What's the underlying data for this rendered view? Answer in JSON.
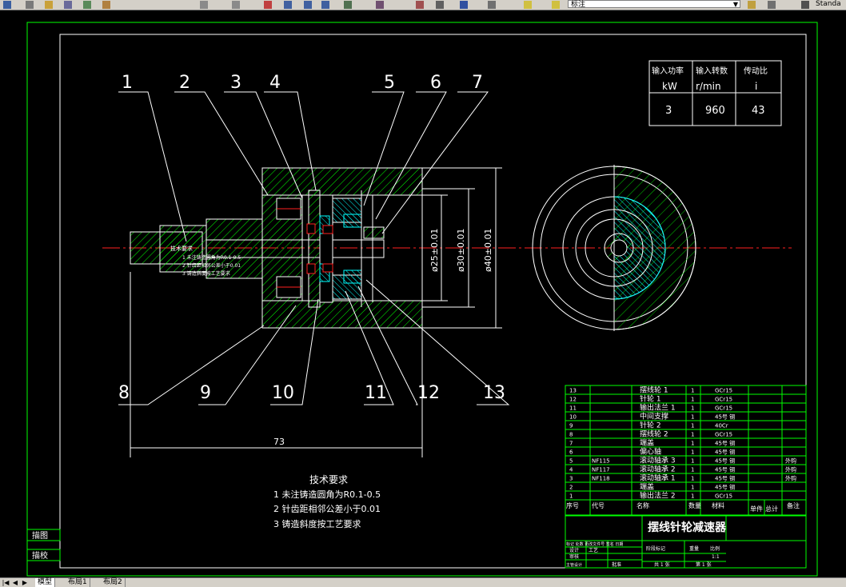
{
  "toolbar": {
    "text_style": "标注",
    "std_label": "Standa"
  },
  "tabs": [
    {
      "label": "模型",
      "active": true
    },
    {
      "label": "布局1",
      "active": false
    },
    {
      "label": "布局2",
      "active": false
    }
  ],
  "part_numbers": [
    "1",
    "2",
    "3",
    "4",
    "5",
    "6",
    "7",
    "8",
    "9",
    "10",
    "11",
    "12",
    "13"
  ],
  "dimensions": {
    "length": "73",
    "d1": "ø25±0.01",
    "d2": "ø30±0.01",
    "d3": "ø40±0.01"
  },
  "notes_box": {
    "title": "技术要求",
    "lines": [
      "1 未注铸造圆角为R0.1-0.5",
      "2 针齿距相邻公差小于0.01",
      "3 铸造斜度按工艺要求"
    ]
  },
  "param_table": {
    "headers": [
      "输入功率",
      "输入转数",
      "传动比"
    ],
    "units": [
      "kW",
      "r/min",
      "i"
    ],
    "values": [
      "3",
      "960",
      "43"
    ]
  },
  "notes": {
    "title": "技术要求",
    "lines": [
      "1 未注铸造圆角为R0.1-0.5",
      "2 针齿距相邻公差小于0.01",
      "3 铸造斜度按工艺要求"
    ]
  },
  "bom": [
    {
      "no": "13",
      "code": "",
      "name": "摆线轮 1",
      "qty": "1",
      "material": "GCr15",
      "note": ""
    },
    {
      "no": "12",
      "code": "",
      "name": "针轮 1",
      "qty": "1",
      "material": "GCr15",
      "note": ""
    },
    {
      "no": "11",
      "code": "",
      "name": "输出法兰 1",
      "qty": "1",
      "material": "GCr15",
      "note": ""
    },
    {
      "no": "10",
      "code": "",
      "name": "中间支撑",
      "qty": "1",
      "material": "45号 钢",
      "note": ""
    },
    {
      "no": "9",
      "code": "",
      "name": "针轮 2",
      "qty": "1",
      "material": "40Cr",
      "note": ""
    },
    {
      "no": "8",
      "code": "",
      "name": "摆线轮 2",
      "qty": "1",
      "material": "GCr15",
      "note": ""
    },
    {
      "no": "7",
      "code": "",
      "name": "端盖",
      "qty": "1",
      "material": "45号 钢",
      "note": ""
    },
    {
      "no": "6",
      "code": "",
      "name": "偏心轴",
      "qty": "1",
      "material": "45号 钢",
      "note": ""
    },
    {
      "no": "5",
      "code": "NF115",
      "name": "滚动轴承 3",
      "qty": "1",
      "material": "45号 钢",
      "note": "外购"
    },
    {
      "no": "4",
      "code": "NF117",
      "name": "滚动轴承 2",
      "qty": "1",
      "material": "45号 钢",
      "note": "外购"
    },
    {
      "no": "3",
      "code": "NF118",
      "name": "滚动轴承 1",
      "qty": "1",
      "material": "45号 钢",
      "note": "外购"
    },
    {
      "no": "2",
      "code": "",
      "name": "端盖",
      "qty": "1",
      "material": "45号 钢",
      "note": ""
    },
    {
      "no": "1",
      "code": "",
      "name": "输出法兰 2",
      "qty": "1",
      "material": "GCr15",
      "note": ""
    }
  ],
  "bom_header": [
    "序号",
    "代号",
    "名称",
    "数量",
    "材料",
    "单件",
    "总计",
    "备注"
  ],
  "title_block": {
    "title": "摆线针轮减速器",
    "rows": [
      "标记 处数 更改文件号 签名 日期",
      "设计",
      "审核",
      "工艺",
      "主管设计",
      "批准"
    ],
    "stage": "阶段标记",
    "weight": "重量",
    "scale": "比例",
    "scale_val": "1:1",
    "sheets": "共 1 张",
    "sheet": "第 1 张"
  },
  "side_labels": [
    "描图",
    "描校"
  ]
}
